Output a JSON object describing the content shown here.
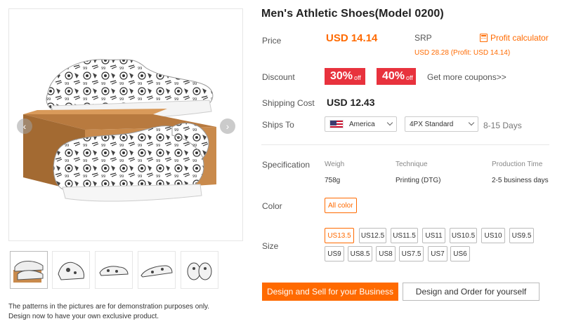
{
  "product": {
    "title": "Men's Athletic Shoes(Model 0200)"
  },
  "gallery": {
    "prev_icon": "chevron-left-icon",
    "next_icon": "chevron-right-icon",
    "thumbnail_count": 5,
    "note_line1": "The patterns in the pictures are for demonstration purposes only.",
    "note_line2": "Design now to have your own exclusive product."
  },
  "price": {
    "label": "Price",
    "value": "USD 14.14",
    "srp_label": "SRP",
    "srp_detail": "USD 28.28 (Profit: USD 14.14)",
    "profit_calculator": "Profit calculator",
    "profit_icon": "calculator-icon"
  },
  "discount": {
    "label": "Discount",
    "coupons": [
      {
        "big": "30%",
        "small": "off"
      },
      {
        "big": "40%",
        "small": "off"
      }
    ],
    "more_link": "Get more coupons>>"
  },
  "shipping": {
    "cost_label": "Shipping Cost",
    "cost_value": "USD 12.43",
    "ships_to_label": "Ships To",
    "country": "America",
    "method": "4PX Standard",
    "days": "8-15 Days"
  },
  "specification": {
    "label": "Specification",
    "headers": [
      "Weigh",
      "Technique",
      "Production Time"
    ],
    "values": [
      "758g",
      "Printing (DTG)",
      "2-5 business days"
    ]
  },
  "color": {
    "label": "Color",
    "selected": "All color"
  },
  "size": {
    "label": "Size",
    "options": [
      "US13.5",
      "US12.5",
      "US11.5",
      "US11",
      "US10.5",
      "US10",
      "US9.5",
      "US9",
      "US8.5",
      "US8",
      "US7.5",
      "US7",
      "US6"
    ],
    "selected": "US13.5"
  },
  "actions": {
    "primary": "Design and Sell for your Business",
    "secondary": "Design and Order for yourself"
  },
  "colors": {
    "accent": "#ff6a00",
    "coupon": "#e8323d"
  }
}
